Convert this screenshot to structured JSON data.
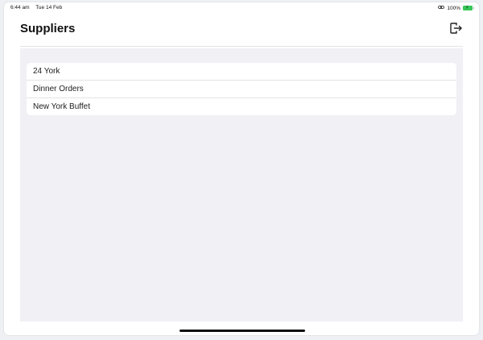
{
  "status_bar": {
    "time": "6:44 am",
    "date": "Tue 14 Feb",
    "battery_percent": "100%",
    "battery_color": "#38c759"
  },
  "header": {
    "title": "Suppliers",
    "logout_icon": "logout-icon"
  },
  "suppliers": [
    {
      "name": "24 York"
    },
    {
      "name": "Dinner Orders"
    },
    {
      "name": "New York Buffet"
    }
  ]
}
